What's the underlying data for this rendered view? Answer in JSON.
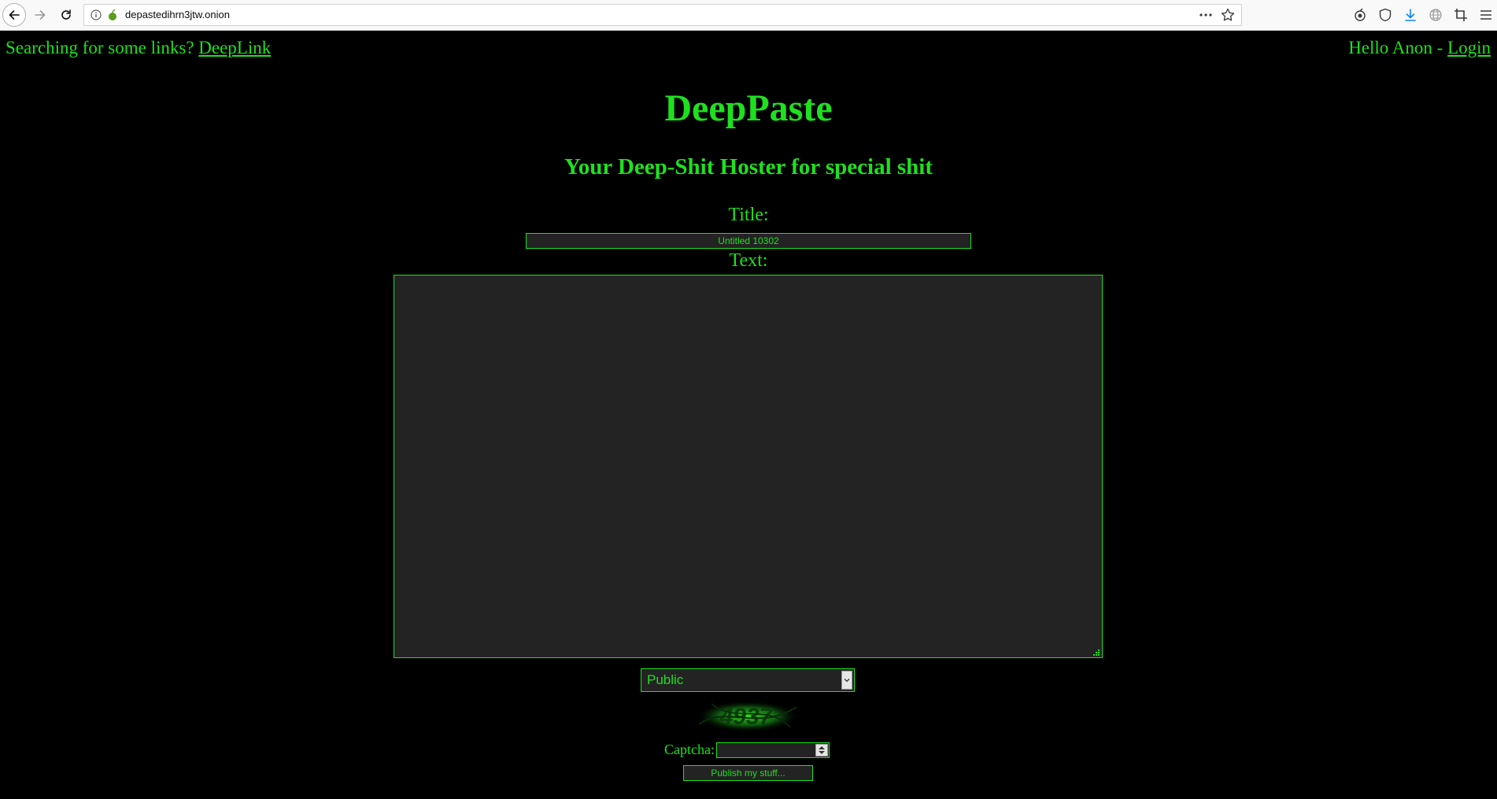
{
  "browser": {
    "url": "depastedihrn3jtw.onion"
  },
  "header": {
    "left_prefix": "Searching for some links?",
    "left_link": "DeepLink",
    "right_prefix": "Hello Anon -",
    "right_link": "Login"
  },
  "site": {
    "title": "DeepPaste",
    "tagline": "Your Deep-Shit Hoster for special shit"
  },
  "form": {
    "title_label": "Title:",
    "title_value": "Untitled 10302",
    "text_label": "Text:",
    "text_value": "",
    "visibility_selected": "Public",
    "captcha_image_text": "4937",
    "captcha_label": "Captcha:",
    "captcha_value": "",
    "publish_label": "Publish my stuff..."
  },
  "colors": {
    "accent": "#1fe01f",
    "background": "#000000",
    "field_background": "#232323"
  }
}
